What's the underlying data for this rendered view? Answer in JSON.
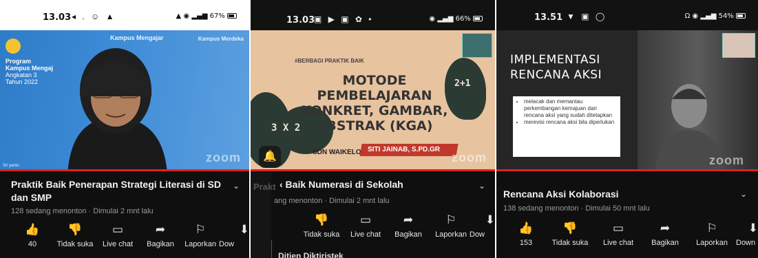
{
  "panels": [
    {
      "status": {
        "time": "13.03",
        "apps": "◂ . ☺ ▲",
        "sys": "67%"
      },
      "video": {
        "logo_kampus": "Kampus Mengajar",
        "logo_merdeka": "Kampus Merdeka",
        "program_line1": "Program",
        "program_line2": "Kampus Mengaj",
        "program_line3": "Angkatan 3",
        "program_line4": "Tahun 2022",
        "speaker_name": "Sri yanto",
        "watermark": "zoom"
      },
      "title": "Praktik Baik Penerapan Strategi Literasi di SD dan SMP",
      "meta": "128 sedang menonton · Dimulai 2 mnt lalu",
      "actions": [
        {
          "icon": "thumbs-up-icon",
          "glyph": "👍",
          "label": "40"
        },
        {
          "icon": "thumbs-down-icon",
          "glyph": "👎",
          "label": "Tidak suka"
        },
        {
          "icon": "live-chat-icon",
          "glyph": "▭",
          "label": "Live chat"
        },
        {
          "icon": "share-icon",
          "glyph": "➦",
          "label": "Bagikan"
        },
        {
          "icon": "flag-icon",
          "glyph": "⚐",
          "label": "Laporkan"
        },
        {
          "icon": "download-icon",
          "glyph": "⬇",
          "label": "Dow"
        }
      ]
    },
    {
      "status": {
        "time": "13.03",
        "apps": "▣ ▶ ▣ ✿ •",
        "sys": "66%"
      },
      "video": {
        "tag": "#BERBAGI PRAKTIK BAIK",
        "title_line1": "MOTODE PEMBELAJARAN",
        "title_line2": "KONKRET, GAMBAR,",
        "title_line3": "ABSTRAK (KGA)",
        "school": "SDN WAIKELO, SUMBA BARAT DAYA, NTT",
        "author": "SITI JAINAB, S.PD.GR",
        "chalk_left": "3 X 2",
        "chalk_right": "2+1",
        "watermark": "zoom"
      },
      "ghost_title": "Prakt",
      "title": "‹ Baik Numerasi di Sekolah",
      "meta": "ang menonton · Dimulai 2 mnt lalu",
      "actions": [
        {
          "icon": "thumbs-down-icon",
          "glyph": "👎",
          "label": "Tidak suka"
        },
        {
          "icon": "live-chat-icon",
          "glyph": "▭",
          "label": "Live chat"
        },
        {
          "icon": "share-icon",
          "glyph": "➦",
          "label": "Bagikan"
        },
        {
          "icon": "flag-icon",
          "glyph": "⚐",
          "label": "Laporkan"
        },
        {
          "icon": "download-icon",
          "glyph": "⬇",
          "label": "Dow"
        }
      ],
      "next": "Ditien Diktiristek"
    },
    {
      "status": {
        "time": "13.51",
        "apps": "▼ ▣ ◯",
        "sys": "54%"
      },
      "video": {
        "heading_line1": "IMPLEMENTASI",
        "heading_line2": "RENCANA AKSI",
        "bullets": [
          "melacak dan memantau perkembangan kemajuan dari rencana aksi yang sudah ditetapkan",
          "merevisi rencana aksi bila diperlukan"
        ],
        "watermark": "zoom"
      },
      "title": "Rencana Aksi Kolaborasi",
      "meta": "138 sedang menonton · Dimulai 50 mnt lalu",
      "actions": [
        {
          "icon": "thumbs-up-icon",
          "glyph": "👍",
          "label": "153"
        },
        {
          "icon": "thumbs-down-icon",
          "glyph": "👎",
          "label": "Tidak suka"
        },
        {
          "icon": "live-chat-icon",
          "glyph": "▭",
          "label": "Live chat"
        },
        {
          "icon": "share-icon",
          "glyph": "➦",
          "label": "Bagikan"
        },
        {
          "icon": "flag-icon",
          "glyph": "⚐",
          "label": "Laporkan"
        },
        {
          "icon": "download-icon",
          "glyph": "⬇",
          "label": "Down"
        }
      ]
    }
  ],
  "colors": {
    "progress": "#e0221e",
    "background": "#0f0f0f",
    "meta_text": "#9a9a9a"
  }
}
